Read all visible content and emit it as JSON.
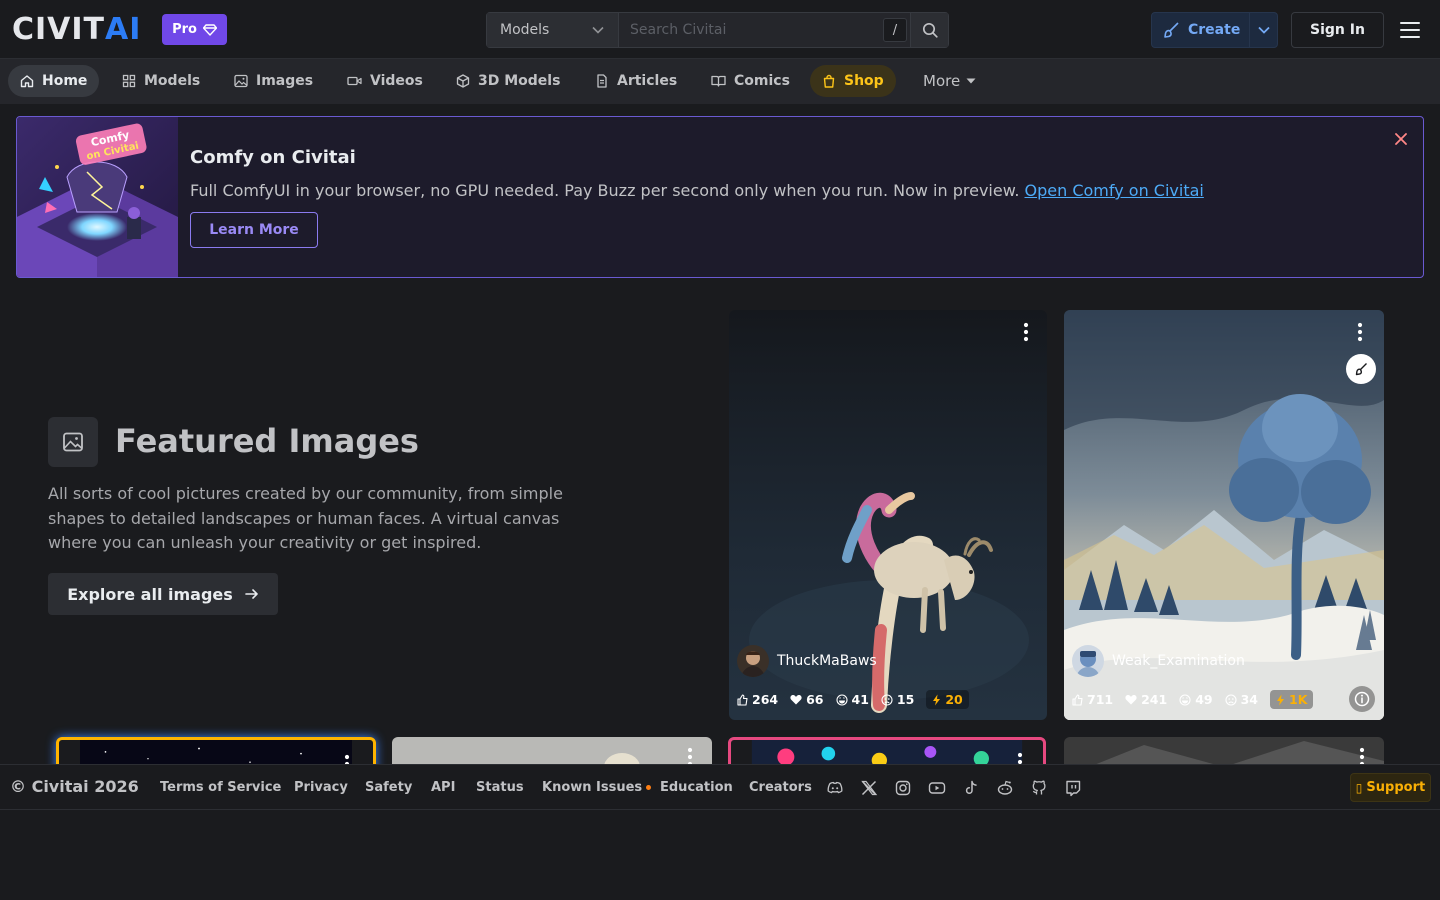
{
  "header": {
    "logo_civ": "CIVIT",
    "logo_ai": "AI",
    "pro_label": "Pro",
    "search": {
      "type_selected": "Models",
      "placeholder": "Search Civitai",
      "shortcut": "/"
    },
    "create_label": "Create",
    "signin_label": "Sign In"
  },
  "nav": {
    "items": [
      {
        "label": "Home",
        "icon": "home-icon"
      },
      {
        "label": "Models",
        "icon": "grid-icon"
      },
      {
        "label": "Images",
        "icon": "photo-icon"
      },
      {
        "label": "Videos",
        "icon": "video-icon"
      },
      {
        "label": "3D Models",
        "icon": "cube-icon"
      },
      {
        "label": "Articles",
        "icon": "file-text-icon"
      },
      {
        "label": "Comics",
        "icon": "book-icon"
      },
      {
        "label": "Shop",
        "icon": "shopping-bag-icon"
      }
    ],
    "more_label": "More"
  },
  "banner": {
    "title": "Comfy on Civitai",
    "description": "Full ComfyUI in your browser, no GPU needed. Pay Buzz per second only when you run. Now in preview.",
    "link_text": "Open Comfy on Civitai",
    "button_label": "Learn More",
    "image_caption_line1": "Comfy",
    "image_caption_line2": "on Civitai"
  },
  "featured": {
    "title": "Featured Images",
    "description": "All sorts of cool pictures created by our community, from simple shapes to detailed landscapes or human faces. A virtual canvas where you can unleash your creativity or get inspired.",
    "button_label": "Explore all images"
  },
  "cards": [
    {
      "username": "ThuckMaBaws",
      "stats": {
        "likes": "264",
        "hearts": "66",
        "laughs": "41",
        "cries": "15",
        "buzz": "20"
      }
    },
    {
      "username": "Weak_Examination",
      "stats": {
        "likes": "711",
        "hearts": "241",
        "laughs": "49",
        "cries": "34",
        "buzz": "1K"
      }
    }
  ],
  "footer": {
    "copyright": "© Civitai 2026",
    "links": [
      "Terms of Service",
      "Privacy",
      "Safety",
      "API",
      "Status",
      "Known Issues",
      "Education",
      "Creators"
    ],
    "social_icons": [
      "discord-icon",
      "x-icon",
      "instagram-icon",
      "youtube-icon",
      "tiktok-icon",
      "reddit-icon",
      "github-icon",
      "twitch-icon"
    ],
    "support_label": "Support"
  },
  "colors": {
    "brand_blue": "#2c7cf5",
    "pro_purple": "#7048e8",
    "shop_yellow": "#fcc419",
    "buzz_orange": "#fab005",
    "banner_border": "#6a5ad1"
  }
}
